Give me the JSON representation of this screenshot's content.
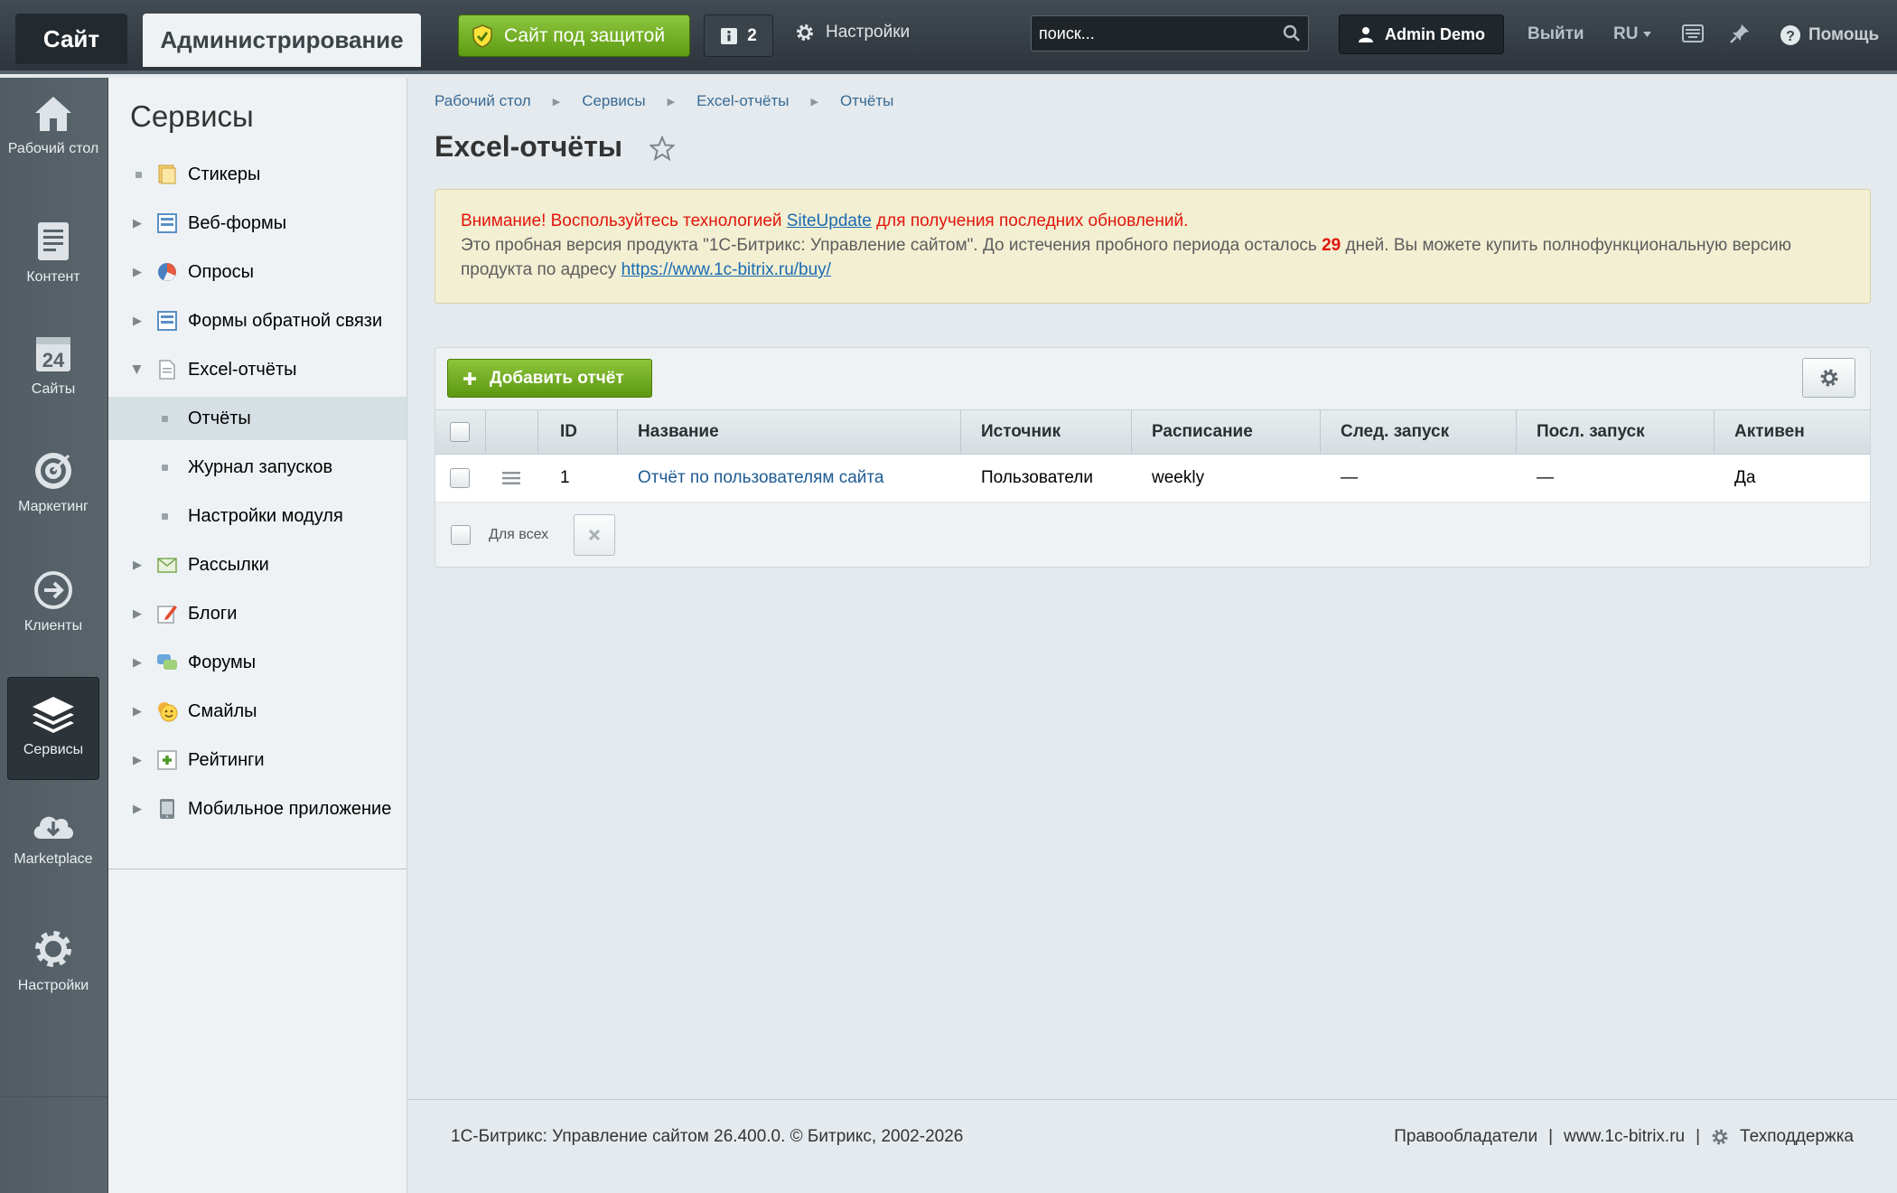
{
  "topbar": {
    "site_tab": "Сайт",
    "admin_tab": "Администрирование",
    "protect_label": "Сайт под защитой",
    "notif_count": "2",
    "settings_label": "Настройки",
    "search_placeholder": "поиск...",
    "user_name": "Admin Demo",
    "logout": "Выйти",
    "lang": "RU",
    "help": "Помощь"
  },
  "leftnav": [
    {
      "label": "Рабочий стол",
      "icon": "home-icon"
    },
    {
      "label": "Контент",
      "icon": "document-icon"
    },
    {
      "label": "Сайты",
      "icon": "calendar-24-icon"
    },
    {
      "label": "Маркетинг",
      "icon": "target-icon"
    },
    {
      "label": "Клиенты",
      "icon": "arrow-circle-icon"
    },
    {
      "label": "Сервисы",
      "icon": "layers-icon",
      "active": true
    },
    {
      "label": "Marketplace",
      "icon": "cloud-download-icon"
    },
    {
      "label": "Настройки",
      "icon": "gear-icon"
    }
  ],
  "sidebar": {
    "title": "Сервисы",
    "items": [
      {
        "label": "Стикеры",
        "marker": "dot",
        "icon": "sticker-icon"
      },
      {
        "label": "Веб-формы",
        "marker": "arrow",
        "icon": "form-icon"
      },
      {
        "label": "Опросы",
        "marker": "arrow",
        "icon": "poll-icon"
      },
      {
        "label": "Формы обратной связи",
        "marker": "arrow",
        "icon": "feedback-form-icon"
      },
      {
        "label": "Excel-отчёты",
        "marker": "arrow-open",
        "icon": "excel-report-icon"
      },
      {
        "label": "Отчёты",
        "marker": "subdot",
        "selected": true
      },
      {
        "label": "Журнал запусков",
        "marker": "subdot"
      },
      {
        "label": "Настройки модуля",
        "marker": "subdot"
      },
      {
        "label": "Рассылки",
        "marker": "arrow",
        "icon": "mail-icon"
      },
      {
        "label": "Блоги",
        "marker": "arrow",
        "icon": "blog-icon"
      },
      {
        "label": "Форумы",
        "marker": "arrow",
        "icon": "forum-icon"
      },
      {
        "label": "Смайлы",
        "marker": "arrow",
        "icon": "smile-icon"
      },
      {
        "label": "Рейтинги",
        "marker": "arrow",
        "icon": "rating-icon"
      },
      {
        "label": "Мобильное приложение",
        "marker": "arrow",
        "icon": "mobile-icon"
      }
    ]
  },
  "breadcrumbs": [
    "Рабочий стол",
    "Сервисы",
    "Excel-отчёты",
    "Отчёты"
  ],
  "page_title": "Excel-отчёты",
  "alert": {
    "line1_prefix": "Внимание! Воспользуйтесь технологией ",
    "line1_link": "SiteUpdate",
    "line1_suffix": " для получения последних обновлений.",
    "line2_prefix": "Это пробная версия продукта \"1С-Битрикс: Управление сайтом\". До истечения пробного периода осталось ",
    "days": "29",
    "line2_suffix": " дней. Вы можете купить полнофункциональную версию продукта по адресу ",
    "buy_link": "https://www.1c-bitrix.ru/buy/"
  },
  "grid": {
    "add_button": "Добавить отчёт",
    "columns": [
      "ID",
      "Название",
      "Источник",
      "Расписание",
      "След. запуск",
      "Посл. запуск",
      "Активен"
    ],
    "rows": [
      {
        "id": "1",
        "name": "Отчёт по пользователям сайта",
        "source": "Пользователи",
        "schedule": "weekly",
        "next_run": "—",
        "last_run": "—",
        "active": "Да"
      }
    ],
    "for_all": "Для всех"
  },
  "footer": {
    "copyright": "1С-Битрикс: Управление сайтом 26.400.0. © Битрикс, 2002-2026",
    "owners": "Правообладатели",
    "site": "www.1c-bitrix.ru",
    "support": "Техподдержка"
  }
}
